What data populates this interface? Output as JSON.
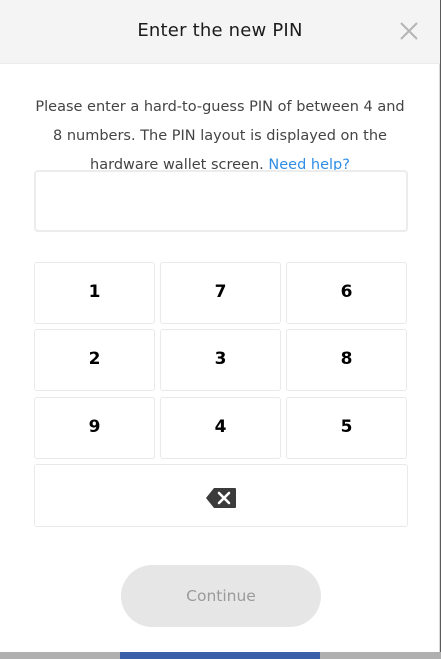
{
  "dialog": {
    "title": "Enter the new PIN",
    "description": "Please enter a hard-to-guess PIN of between 4 and 8 numbers. The PIN layout is displayed on the hardware wallet screen.",
    "help_link": "Need help?",
    "pin_value": "",
    "close_icon": "close-icon",
    "backspace_icon": "backspace-icon",
    "continue_label": "Continue",
    "continue_enabled": false
  },
  "keypad": {
    "keys": [
      "1",
      "7",
      "6",
      "2",
      "3",
      "8",
      "9",
      "4",
      "5"
    ]
  },
  "colors": {
    "link": "#2f8de4",
    "button_disabled_bg": "#e6e6e6",
    "button_disabled_text": "#9a9a9a"
  }
}
